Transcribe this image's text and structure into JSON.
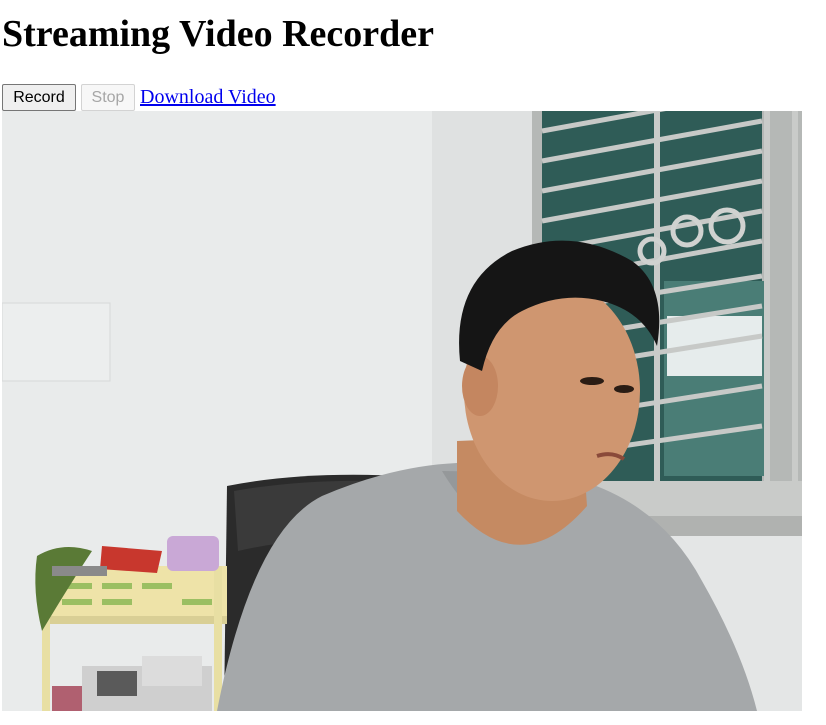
{
  "page": {
    "title": "Streaming Video Recorder"
  },
  "controls": {
    "record_label": "Record",
    "stop_label": "Stop",
    "download_label": "Download Video"
  },
  "video": {
    "content": "webcam-feed"
  }
}
